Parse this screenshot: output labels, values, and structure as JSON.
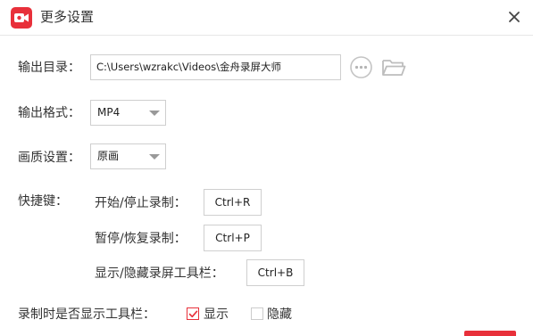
{
  "window": {
    "title": "更多设置",
    "accent_color": "#e8303a"
  },
  "output_dir": {
    "label": "输出目录：",
    "value": "C:\\Users\\wzrakc\\Videos\\金舟录屏大师"
  },
  "output_format": {
    "label": "输出格式：",
    "selected": "MP4"
  },
  "quality": {
    "label": "画质设置：",
    "selected": "原画"
  },
  "shortcuts": {
    "label": "快捷键：",
    "items": [
      {
        "label": "开始/停止录制：",
        "key": "Ctrl+R"
      },
      {
        "label": "暂停/恢复录制：",
        "key": "Ctrl+P"
      },
      {
        "label": "显示/隐藏录屏工具栏：",
        "key": "Ctrl+B"
      }
    ]
  },
  "toolbar_visibility": {
    "label": "录制时是否显示工具栏：",
    "options": [
      {
        "label": "显示",
        "checked": true
      },
      {
        "label": "隐藏",
        "checked": false
      }
    ]
  }
}
